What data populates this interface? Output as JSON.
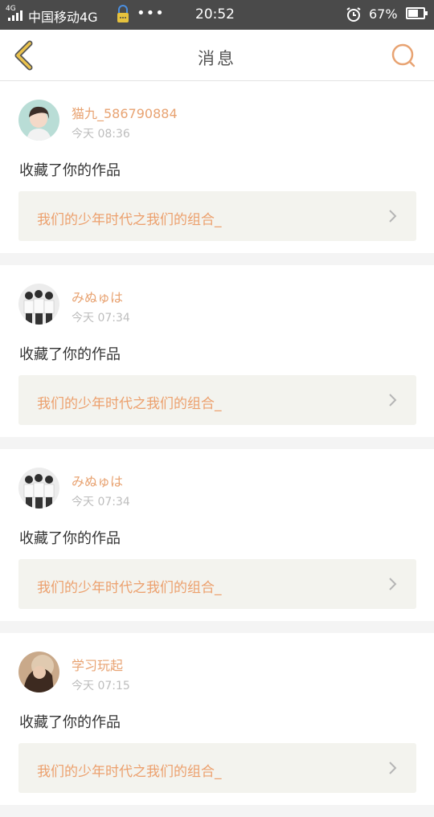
{
  "status_bar": {
    "network_type": "4G",
    "carrier": "中国移动4G",
    "more": "•••",
    "time": "20:52",
    "battery_percent": "67%",
    "battery_level": 0.67,
    "icons": [
      "signal-icon",
      "lock-icon",
      "alarm-icon",
      "battery-icon"
    ]
  },
  "nav": {
    "title": "消息",
    "accent_color": "#e8a372",
    "back_icon_color": "#ebc34d"
  },
  "messages": [
    {
      "username": "猫九_586790884",
      "time": "今天 08:36",
      "action": "收藏了你的作品",
      "work_title": "我们的少年时代之我们的组合_"
    },
    {
      "username": "みぬゅは",
      "time": "今天 07:34",
      "action": "收藏了你的作品",
      "work_title": "我们的少年时代之我们的组合_"
    },
    {
      "username": "みぬゅは",
      "time": "今天 07:34",
      "action": "收藏了你的作品",
      "work_title": "我们的少年时代之我们的组合_"
    },
    {
      "username": "学习玩起",
      "time": "今天 07:15",
      "action": "收藏了你的作品",
      "work_title": "我们的少年时代之我们的组合_"
    }
  ]
}
